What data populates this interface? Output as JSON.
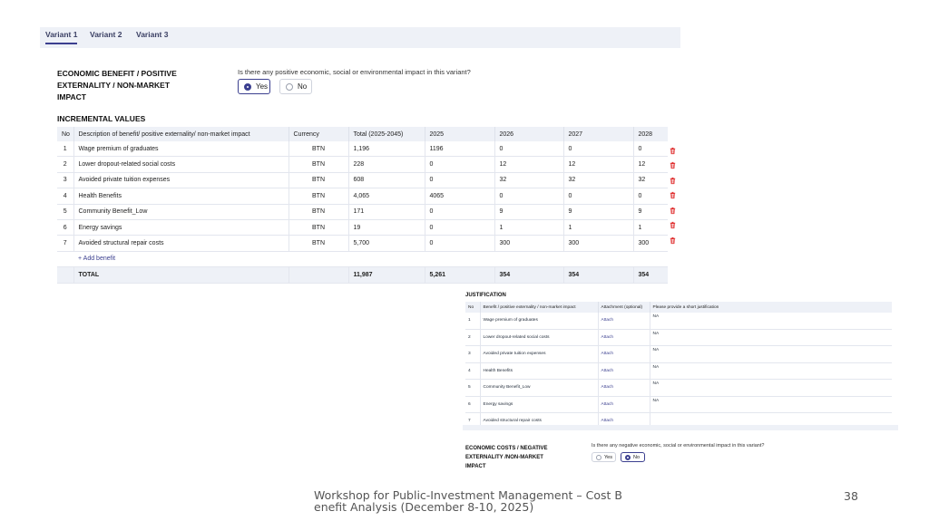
{
  "tabs": [
    {
      "label": "Variant 1",
      "active": true
    },
    {
      "label": "Variant 2",
      "active": false
    },
    {
      "label": "Variant 3",
      "active": false
    }
  ],
  "benefit_section": {
    "title_lines": [
      "ECONOMIC BENEFIT / POSITIVE",
      "EXTERNALITY / NON-MARKET",
      "IMPACT"
    ],
    "question": "Is there any positive economic, social or environmental impact in this variant?",
    "options": [
      {
        "label": "Yes",
        "selected": true
      },
      {
        "label": "No",
        "selected": false
      }
    ]
  },
  "incremental": {
    "title": "INCREMENTAL VALUES",
    "headers": [
      "No",
      "Description of benefit/ positive externality/ non-market impact",
      "Currency",
      "Total (2025-2045)",
      "2025",
      "2026",
      "2027",
      "2028"
    ],
    "rows": [
      [
        "1",
        "Wage premium of graduates",
        "BTN",
        "1,196",
        "1196",
        "0",
        "0",
        "0"
      ],
      [
        "2",
        "Lower dropout-related social costs",
        "BTN",
        "228",
        "0",
        "12",
        "12",
        "12"
      ],
      [
        "3",
        "Avoided private tuition expenses",
        "BTN",
        "608",
        "0",
        "32",
        "32",
        "32"
      ],
      [
        "4",
        "Health Benefits",
        "BTN",
        "4,065",
        "4065",
        "0",
        "0",
        "0"
      ],
      [
        "5",
        "Community Benefit_Low",
        "BTN",
        "171",
        "0",
        "9",
        "9",
        "9"
      ],
      [
        "6",
        "Energy savings",
        "BTN",
        "19",
        "0",
        "1",
        "1",
        "1"
      ],
      [
        "7",
        "Avoided structural repair costs",
        "BTN",
        "5,700",
        "0",
        "300",
        "300",
        "300"
      ]
    ],
    "add_label": "+ Add benefit",
    "total": [
      "TOTAL",
      "11,987",
      "5,261",
      "354",
      "354",
      "354"
    ]
  },
  "justification": {
    "title": "JUSTIFICATION",
    "headers": [
      "No",
      "Benefit / positive externality / non-market impact",
      "Attachment (optional)",
      "Please provide a short justification"
    ],
    "rows": [
      [
        "1",
        "Wage premium of graduates",
        "Attach",
        "NA"
      ],
      [
        "2",
        "Lower dropout-related social costs",
        "Attach",
        "NA"
      ],
      [
        "3",
        "Avoided private tuition expenses",
        "Attach",
        "NA"
      ],
      [
        "4",
        "Health Benefits",
        "Attach",
        "NA"
      ],
      [
        "5",
        "Community Benefit_Low",
        "Attach",
        "NA"
      ],
      [
        "6",
        "Energy savings",
        "Attach",
        "NA"
      ],
      [
        "7",
        "Avoided structural repair costs",
        "Attach",
        ""
      ]
    ]
  },
  "costs_section": {
    "title_lines": [
      "ECONOMIC COSTS / NEGATIVE",
      "EXTERNALITY /NON-MARKET",
      "IMPACT"
    ],
    "question": "Is there any negative economic, social or environmental impact in this variant?",
    "options": [
      {
        "label": "Yes",
        "selected": false
      },
      {
        "label": "No",
        "selected": true
      }
    ]
  },
  "footer": {
    "text": "Workshop for Public-Investment Management – Cost Benefit Analysis (December 8-10, 2025)",
    "page": "38"
  }
}
